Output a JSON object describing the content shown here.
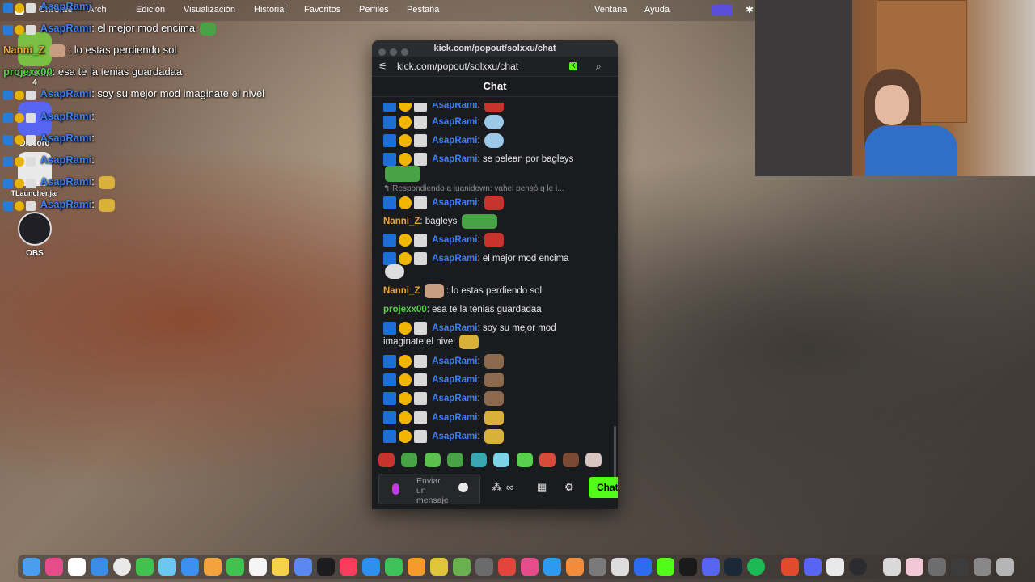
{
  "menubar": {
    "app_name": "Chrome",
    "items": [
      "Arch",
      "Edición",
      "Visualización",
      "Historial",
      "Favoritos",
      "Perfiles",
      "Pestaña",
      "Ventana",
      "Ayuda"
    ]
  },
  "desktop": {
    "icons": [
      {
        "label": "Los Sims 4",
        "name": "sims-icon"
      },
      {
        "label": "Discord",
        "name": "discord-icon"
      },
      {
        "label": "TLauncher.jar",
        "name": "tlauncher-icon"
      },
      {
        "label": "OBS",
        "name": "obs-icon"
      }
    ]
  },
  "overlay": {
    "lines": [
      {
        "user": "AsapRami",
        "text": "",
        "color": "#3f7ef0"
      },
      {
        "user": "AsapRami",
        "text": ": el mejor mod encima",
        "color": "#3f7ef0"
      },
      {
        "user": "Nanni_Z",
        "text": ": lo estas perdiendo sol",
        "color": "#e8a53a"
      },
      {
        "user": "projexx00",
        "text": ": esa te la tenias guardadaa",
        "color": "#58d04b"
      },
      {
        "user": "AsapRami",
        "text": ": soy su mejor mod imaginate el nivel",
        "color": "#3f7ef0"
      },
      {
        "user": "AsapRami",
        "text": ":",
        "color": "#3f7ef0"
      },
      {
        "user": "AsapRami",
        "text": ":",
        "color": "#3f7ef0"
      },
      {
        "user": "AsapRami",
        "text": ":",
        "color": "#3f7ef0"
      },
      {
        "user": "AsapRami",
        "text": ":",
        "color": "#3f7ef0"
      },
      {
        "user": "AsapRami",
        "text": ":",
        "color": "#3f7ef0"
      }
    ]
  },
  "popup": {
    "window_title": "kick.com/popout/solxxu/chat",
    "url": "kick.com/popout/solxxu/chat",
    "chat_header": "Chat",
    "reply_text": "Respondiendo a juanidown: vahel pensó q le i...",
    "messages": [
      {
        "user": "AsapRami",
        "text": ":",
        "color": "#3f7ef0",
        "emote": "e-red"
      },
      {
        "user": "AsapRami",
        "text": ":",
        "color": "#3f7ef0",
        "emote": "e-blue"
      },
      {
        "user": "AsapRami",
        "text": ":",
        "color": "#3f7ef0",
        "emote": "e-blue"
      },
      {
        "user": "AsapRami",
        "text": ": se pelean por bagleys",
        "color": "#3f7ef0",
        "emote": ""
      },
      {
        "user": "AsapRami",
        "text": ":",
        "color": "#3f7ef0",
        "emote": "e-red"
      },
      {
        "user": "Nanni_Z",
        "text": ": bagleys",
        "color": "#e8a53a",
        "emote": "e-green"
      },
      {
        "user": "AsapRami",
        "text": ":",
        "color": "#3f7ef0",
        "emote": "e-red"
      },
      {
        "user": "AsapRami",
        "text": ": el mejor mod encima",
        "color": "#3f7ef0",
        "emote": ""
      },
      {
        "user": "Nanni_Z",
        "text": ": lo estas perdiendo sol",
        "color": "#e8a53a",
        "emote": "e-face"
      },
      {
        "user": "projexx00",
        "text": ": esa te la tenias guardadaa",
        "color": "#58d04b",
        "emote": ""
      },
      {
        "user": "AsapRami",
        "text": ": soy su mejor mod",
        "color": "#3f7ef0",
        "emote": ""
      },
      {
        "user": "",
        "text": "imaginate el nivel",
        "color": "#e8e8e8",
        "emote": "e-gold"
      },
      {
        "user": "AsapRami",
        "text": ":",
        "color": "#3f7ef0",
        "emote": "e-brown"
      },
      {
        "user": "AsapRami",
        "text": ":",
        "color": "#3f7ef0",
        "emote": "e-brown"
      },
      {
        "user": "AsapRami",
        "text": ":",
        "color": "#3f7ef0",
        "emote": "e-brown"
      },
      {
        "user": "AsapRami",
        "text": ":",
        "color": "#3f7ef0",
        "emote": "e-gold"
      },
      {
        "user": "AsapRami",
        "text": ":",
        "color": "#3f7ef0",
        "emote": "e-gold"
      }
    ],
    "input_placeholder": "Enviar un mensaje",
    "send_label": "Chat",
    "accent_color": "#53fc18"
  },
  "webcam": {
    "label": "webcam-feed"
  }
}
